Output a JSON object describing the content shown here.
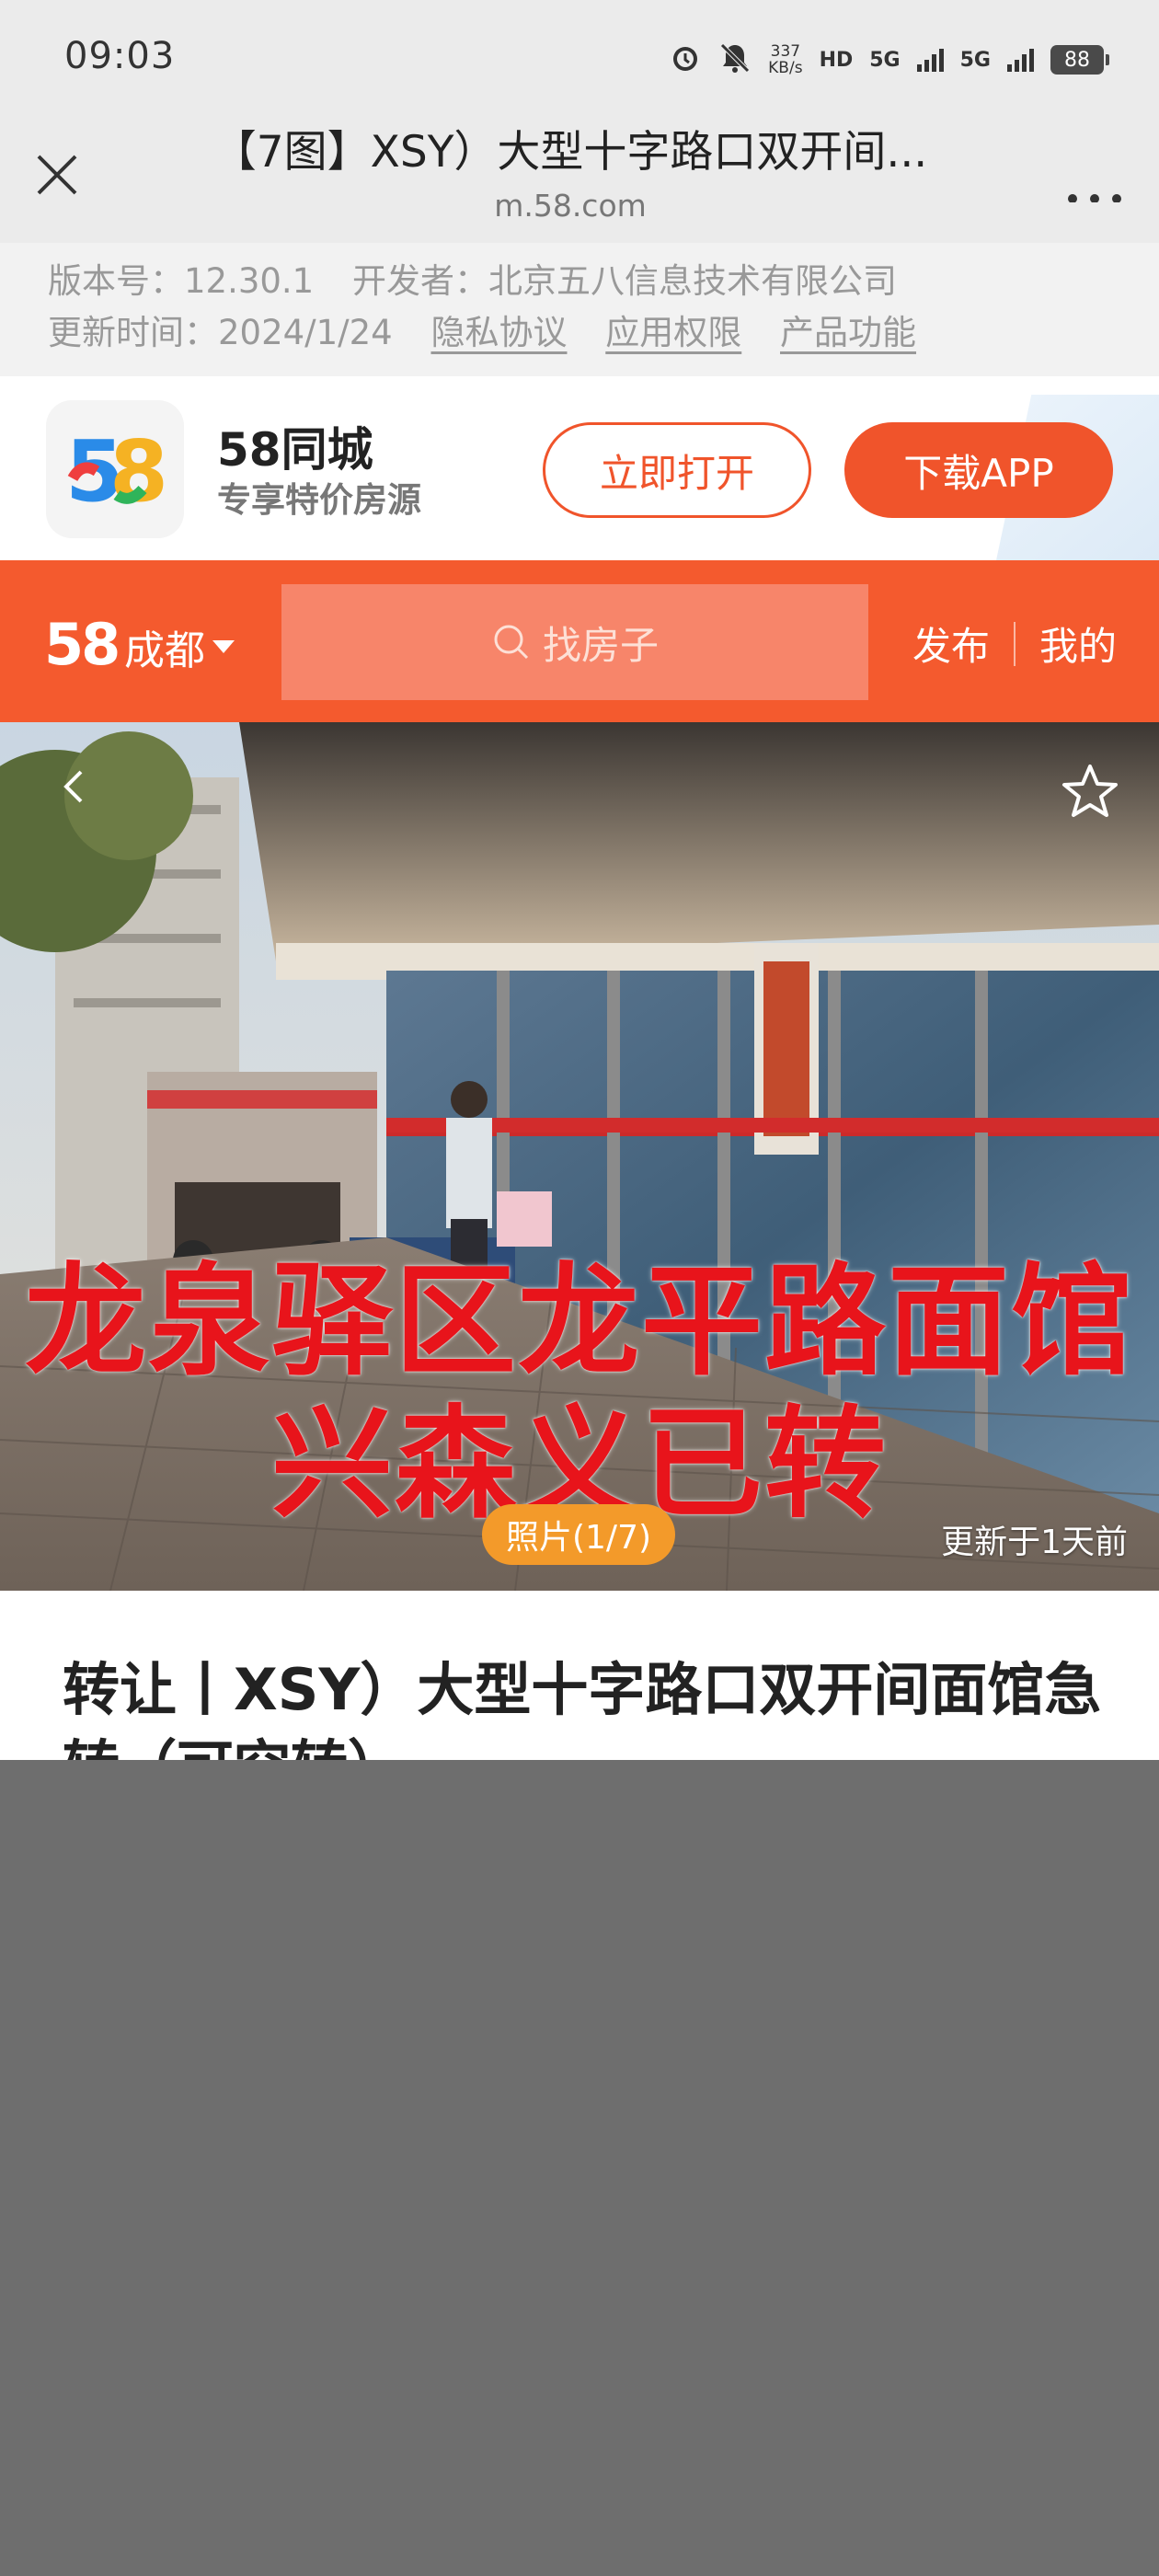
{
  "status_bar": {
    "time": "09:03",
    "net_speed_value": "337",
    "net_speed_unit": "KB/s",
    "hd_label": "HD",
    "signal_1": "5G",
    "signal_2": "5G",
    "battery": "88"
  },
  "browser": {
    "title": "【7图】XSY）大型十字路口双开间...",
    "domain": "m.58.com"
  },
  "app_info": {
    "version": "版本号：12.30.1",
    "developer": "开发者：北京五八信息技术有限公司",
    "updated": "更新时间：2024/1/24",
    "links": [
      "隐私协议",
      "应用权限",
      "产品功能"
    ]
  },
  "banner": {
    "app_name": "58同城",
    "slogan": "专享特价房源",
    "open_label": "立即打开",
    "download_label": "下载APP"
  },
  "site_nav": {
    "logo": "58",
    "city": "成都",
    "search_placeholder": "找房子",
    "publish": "发布",
    "mine": "我的"
  },
  "hero": {
    "overlay_line1": "龙泉驿区龙平路面馆",
    "overlay_line2": "兴森义已转",
    "photo_counter": "照片(1/7)",
    "update_time": "更新于1天前"
  },
  "listing": {
    "title": "转让丨XSY）大型十字路口双开间面馆急转（可空转）"
  },
  "colors": {
    "brand_orange": "#f45a2e",
    "button_orange": "#f0542b",
    "overlay_red": "#e8141b",
    "counter_orange": "#f39a2a"
  }
}
